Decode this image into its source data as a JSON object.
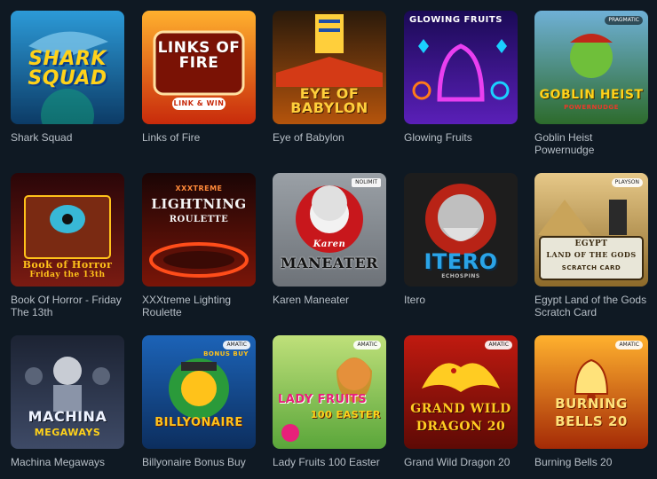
{
  "games": [
    {
      "id": "shark-squad",
      "label": "Shark Squad",
      "art_title": "SHARK SQUAD",
      "colors": {
        "top": "#2c9ad7",
        "bottom": "#0c3b66",
        "accent": "#ffd21a"
      }
    },
    {
      "id": "links-of-fire",
      "label": "Links of Fire",
      "art_title": "LINKS OF FIRE",
      "art_sub": "LINK & WIN",
      "colors": {
        "top": "#ffb02e",
        "bottom": "#c82a0b",
        "accent": "#ffffff"
      }
    },
    {
      "id": "eye-of-babylon",
      "label": "Eye of Babylon",
      "art_title": "EYE OF BABYLON",
      "colors": {
        "top": "#2a1a0b",
        "bottom": "#b5540c",
        "accent": "#ffcf3b"
      }
    },
    {
      "id": "glowing-fruits",
      "label": "Glowing Fruits",
      "art_title": "GLOWING FRUITS",
      "colors": {
        "top": "#1a0a55",
        "bottom": "#5a1fb8",
        "accent": "#e93ff0"
      }
    },
    {
      "id": "goblin-heist",
      "label": "Goblin Heist Powernudge",
      "art_title": "GOBLIN HEIST",
      "art_sub": "POWERNUDGE",
      "badge": "PRAGMATIC",
      "colors": {
        "top": "#6fb0d6",
        "bottom": "#2d6b2c",
        "accent": "#ffd21a"
      }
    },
    {
      "id": "book-of-horror",
      "label": "Book Of Horror - Friday The 13th",
      "art_title": "Book of Horror",
      "art_sub": "Friday the 13th",
      "colors": {
        "top": "#2a0608",
        "bottom": "#7a1b12",
        "accent": "#ffc21a"
      }
    },
    {
      "id": "xxxtreme-lightning",
      "label": "XXXtreme Lighting Roulette",
      "art_title": "LIGHTNING",
      "art_sub": "ROULETTE",
      "art_top": "XXXTREME",
      "colors": {
        "top": "#1a0505",
        "bottom": "#7a1508",
        "accent": "#ff4d1a"
      }
    },
    {
      "id": "karen-maneater",
      "label": "Karen Maneater",
      "art_title": "MANEATER",
      "art_sub": "Karen",
      "badge": "NOLIMIT",
      "colors": {
        "top": "#9aa0a6",
        "bottom": "#6d7278",
        "accent": "#c8171c"
      }
    },
    {
      "id": "itero",
      "label": "Itero",
      "art_title": "ITERO",
      "art_sub": "ECHOSPINS",
      "colors": {
        "top": "#151515",
        "bottom": "#2a2a2a",
        "accent": "#b82316"
      }
    },
    {
      "id": "egypt-land",
      "label": "Egypt Land of the Gods Scratch Card",
      "art_title": "EGYPT",
      "art_sub": "LAND OF THE GODS",
      "art_tag": "SCRATCH CARD",
      "badge": "PLAYSON",
      "colors": {
        "top": "#e6c888",
        "bottom": "#8d6a2a",
        "accent": "#3a2a10"
      }
    },
    {
      "id": "machina-megaways",
      "label": "Machina Megaways",
      "art_title": "MACHINA",
      "art_sub": "MEGAWAYS",
      "colors": {
        "top": "#1c2333",
        "bottom": "#3e4a66",
        "accent": "#ffd21a"
      }
    },
    {
      "id": "billyonaire",
      "label": "Billyonaire Bonus Buy",
      "art_title": "BILLYONAIRE",
      "badge": "AMATIC",
      "art_tag": "BONUS BUY",
      "colors": {
        "top": "#1c63b7",
        "bottom": "#0c2e5e",
        "accent": "#ffc21a"
      }
    },
    {
      "id": "lady-fruits",
      "label": "Lady Fruits 100 Easter",
      "art_title": "LADY FRUITS",
      "art_sub": "100 EASTER",
      "badge": "AMATIC",
      "colors": {
        "top": "#bfe07a",
        "bottom": "#5aa63a",
        "accent": "#e8207a"
      }
    },
    {
      "id": "grand-wild-dragon",
      "label": "Grand Wild Dragon 20",
      "art_title": "GRAND WILD",
      "art_sub": "DRAGON 20",
      "badge": "AMATIC",
      "colors": {
        "top": "#c01a10",
        "bottom": "#5e0a05",
        "accent": "#ffcc22"
      }
    },
    {
      "id": "burning-bells",
      "label": "Burning Bells 20",
      "art_title": "BURNING",
      "art_sub": "BELLS 20",
      "badge": "AMATIC",
      "colors": {
        "top": "#ffb12e",
        "bottom": "#a42a06",
        "accent": "#ffe27a"
      }
    }
  ]
}
